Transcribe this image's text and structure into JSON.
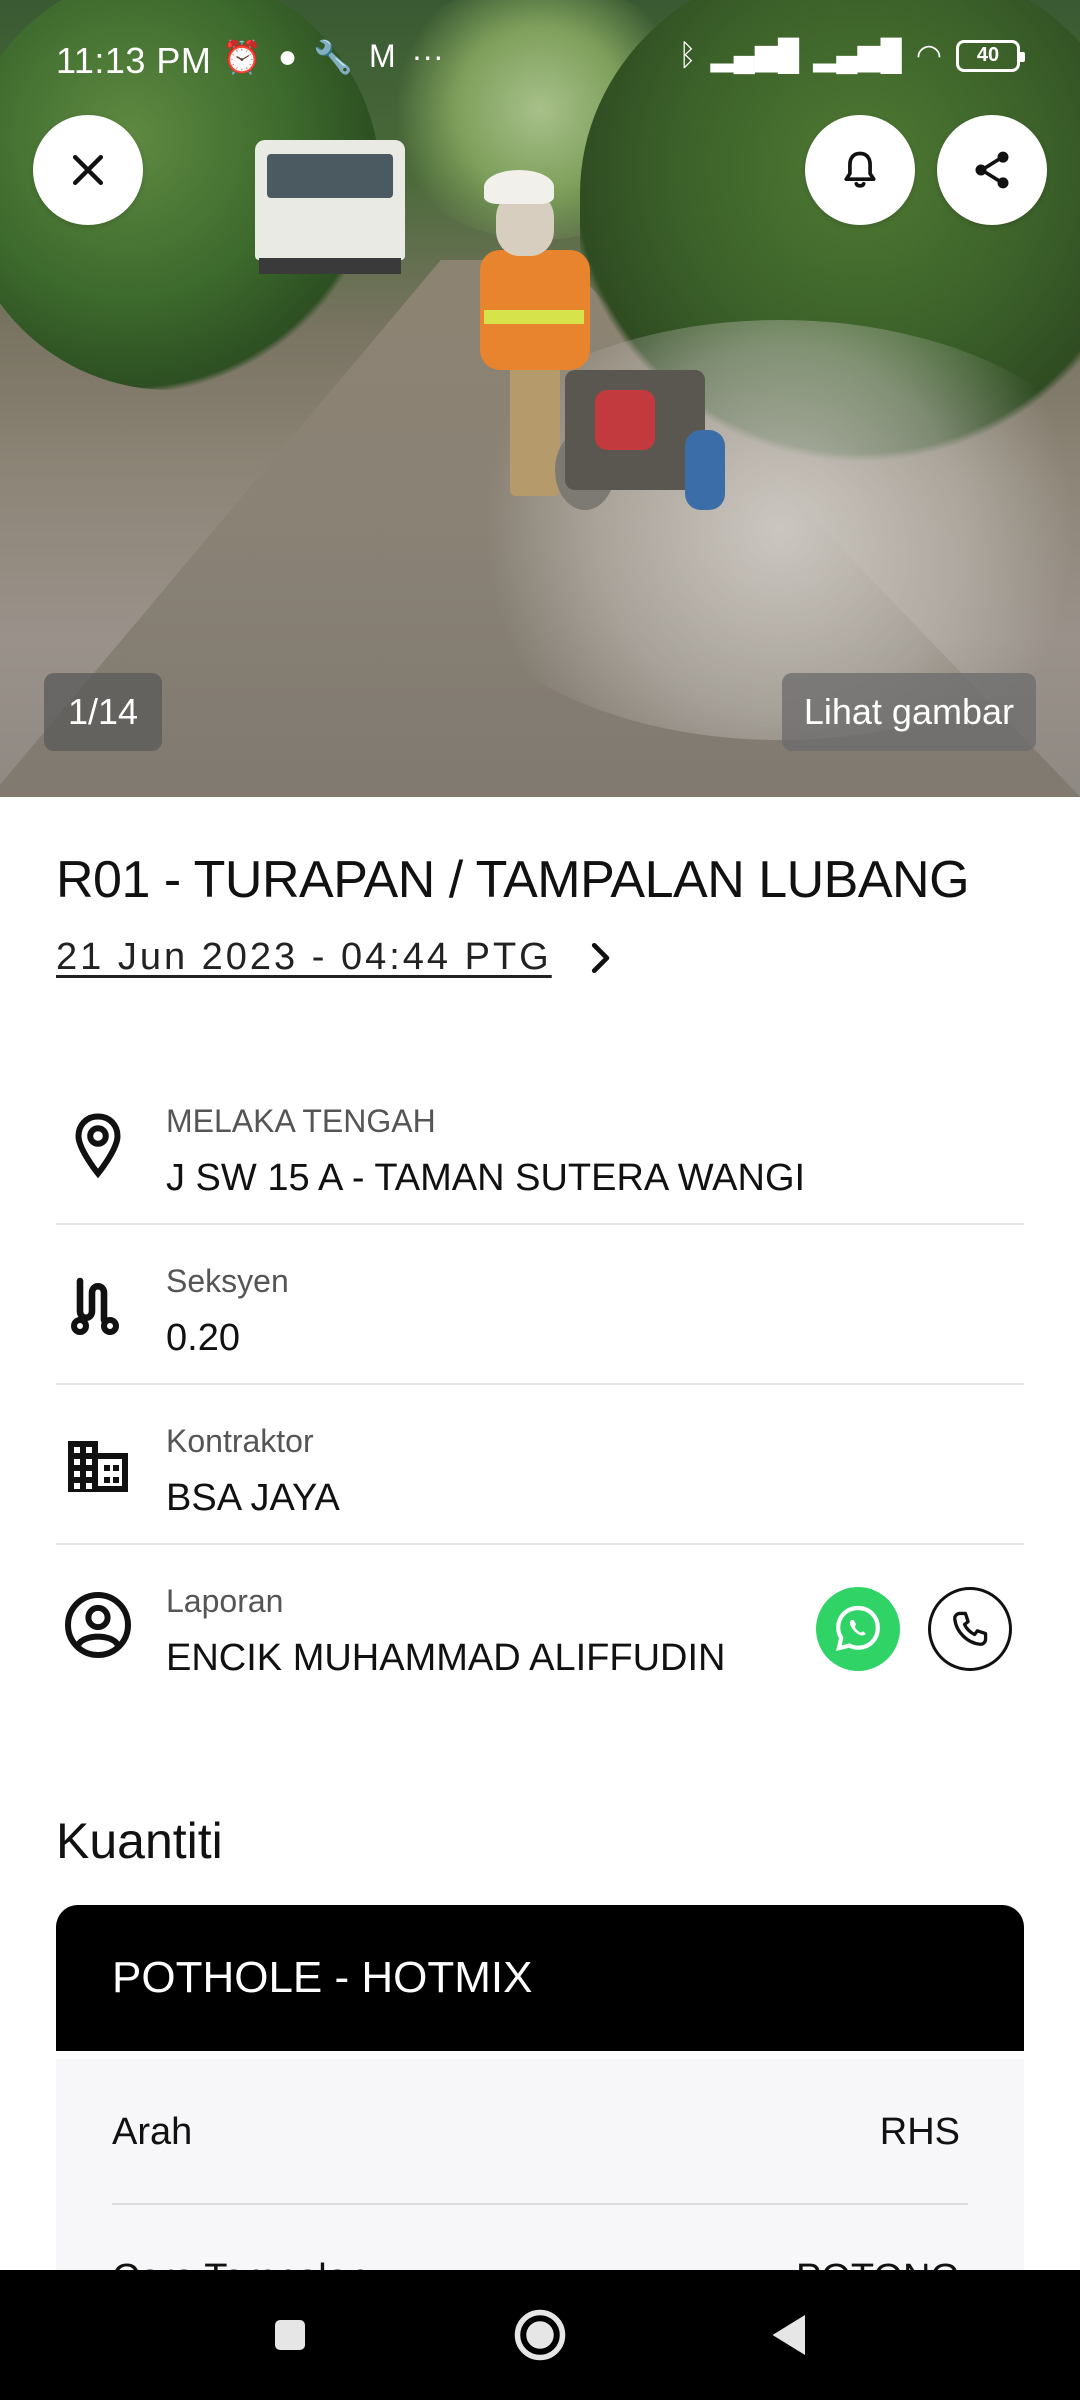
{
  "status_bar": {
    "time": "11:13 PM",
    "battery": "40"
  },
  "hero": {
    "counter": "1/14",
    "view_label": "Lihat gambar"
  },
  "report": {
    "title": "R01 - TURAPAN / TAMPALAN LUBANG",
    "datetime": "21 Jun 2023 - 04:44 PTG"
  },
  "details": {
    "location": {
      "label": "MELAKA TENGAH",
      "value": "J SW 15 A - TAMAN SUTERA WANGI"
    },
    "section": {
      "label": "Seksyen",
      "value": "0.20"
    },
    "contractor": {
      "label": "Kontraktor",
      "value": "BSA JAYA"
    },
    "reporter": {
      "label": "Laporan",
      "value": "ENCIK MUHAMMAD ALIFFUDIN"
    }
  },
  "quantity": {
    "title": "Kuantiti",
    "card_title": "POTHOLE - HOTMIX",
    "rows": [
      {
        "key": "Arah",
        "value": "RHS"
      },
      {
        "key": "Cara Tampalan",
        "value": "POTONG"
      }
    ]
  },
  "colors": {
    "whatsapp": "#2fd366",
    "card_header": "#000000",
    "divider": "#e3e3e3"
  }
}
